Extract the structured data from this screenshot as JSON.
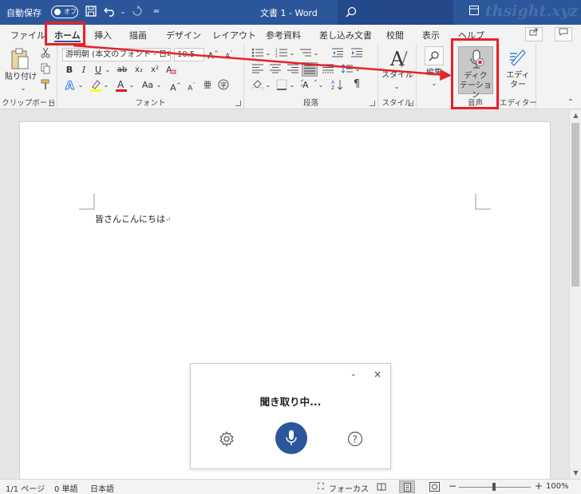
{
  "titlebar": {
    "autosave_label": "自動保存",
    "autosave_state": "オフ",
    "doc_title": "文書 1  -  Word",
    "watermark": "thsight.xyz"
  },
  "tabs": [
    "ファイル",
    "ホーム",
    "挿入",
    "描画",
    "デザイン",
    "レイアウト",
    "参考資料",
    "差し込み文書",
    "校閲",
    "表示",
    "ヘルプ"
  ],
  "active_tab": "ホーム",
  "ribbon": {
    "clipboard": {
      "paste_label": "貼り付け",
      "group_label": "クリップボード"
    },
    "font": {
      "font_name": "游明朝 (本文のフォント - 日本",
      "font_size": "10.5",
      "group_label": "フォント",
      "bold": "B",
      "italic": "I",
      "underline": "U",
      "strike": "ab",
      "subscript": "x₂",
      "superscript": "x²",
      "change_case": "Aa",
      "grow": "A",
      "shrink": "A"
    },
    "paragraph": {
      "group_label": "段落"
    },
    "styles": {
      "label": "スタイル",
      "group_label": "スタイル"
    },
    "editing": {
      "label": "編集"
    },
    "voice": {
      "dictate_label": "ディク\nテーション",
      "group_label": "音声"
    },
    "editor": {
      "label": "エディ\nター",
      "group_label": "エディター"
    }
  },
  "document": {
    "text": "皆さんこんにちは",
    "para_mark": "↵"
  },
  "dictation": {
    "status": "聞き取り中..."
  },
  "statusbar": {
    "page": "1/1 ページ",
    "words": "0 単語",
    "language": "日本語",
    "focus": "フォーカス",
    "zoom": "100%",
    "zoom_level": 1.0
  },
  "colors": {
    "brand": "#2b579a",
    "annotation": "#e8212a",
    "highlight_yellow": "#ffff00",
    "font_red": "#e81123"
  }
}
